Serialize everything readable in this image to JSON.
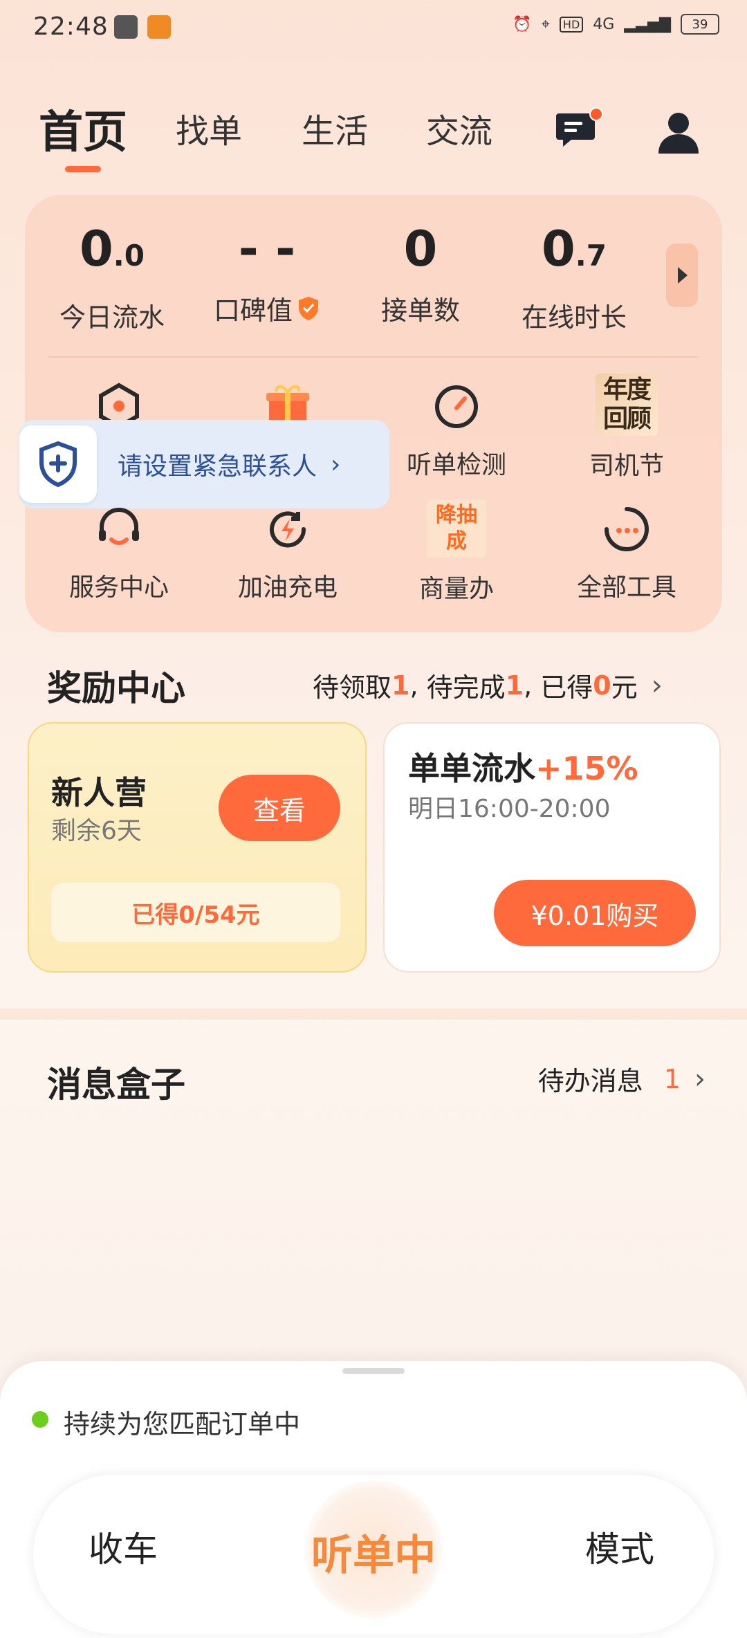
{
  "status_bar": {
    "time": "22:48",
    "network": "4G",
    "battery": "39"
  },
  "nav": {
    "tabs": [
      "首页",
      "找单",
      "生活",
      "交流"
    ],
    "active": "首页"
  },
  "stats": [
    {
      "value_main": "0",
      "value_decimal": ".0",
      "label": "今日流水"
    },
    {
      "value_main": "- -",
      "value_decimal": "",
      "label": "口碑值"
    },
    {
      "value_main": "0",
      "value_decimal": "",
      "label": "接单数"
    },
    {
      "value_main": "0",
      "value_decimal": ".7",
      "label": "在线时长"
    }
  ],
  "tools": {
    "row1": [
      "听单检测",
      "司机节"
    ],
    "row2": [
      "服务中心",
      "加油充电",
      "商量办",
      "全部工具"
    ],
    "driver_festival_badge": "年度回顾",
    "discuss_badge": "降抽成"
  },
  "emergency": {
    "text": "请设置紧急联系人"
  },
  "reward": {
    "title": "奖励中心",
    "pending_claim_label": "待领取",
    "pending_claim": "1",
    "pending_complete_label": "待完成",
    "pending_complete": "1",
    "earned_label": "已得",
    "earned": "0",
    "unit": "元"
  },
  "new_camp": {
    "title": "新人营",
    "subtitle": "剩余6天",
    "button": "查看",
    "earned": "已得0/54元"
  },
  "flow_card": {
    "title": "单单流水",
    "bonus": "+15%",
    "time": "明日16:00-20:00",
    "button": "¥0.01购买"
  },
  "message_box": {
    "title": "消息盒子",
    "pending_label": "待办消息",
    "pending_count": "1"
  },
  "bottom": {
    "matching_text": "持续为您匹配订单中",
    "left": "收车",
    "center": "听单中",
    "right": "模式"
  }
}
